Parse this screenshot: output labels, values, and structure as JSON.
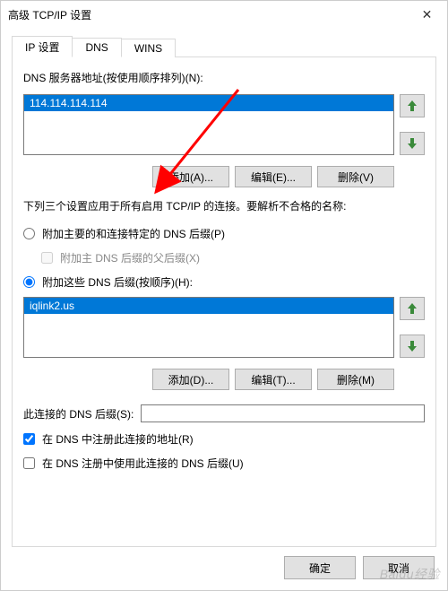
{
  "window": {
    "title": "高级 TCP/IP 设置",
    "close_glyph": "✕"
  },
  "tabs": {
    "ip": "IP 设置",
    "dns": "DNS",
    "wins": "WINS"
  },
  "dns": {
    "server_list_label": "DNS 服务器地址(按使用顺序排列)(N):",
    "servers": [
      "114.114.114.114"
    ],
    "btn_add": "添加(A)...",
    "btn_edit": "编辑(E)...",
    "btn_remove": "删除(V)",
    "resolve_desc": "下列三个设置应用于所有启用 TCP/IP 的连接。要解析不合格的名称:",
    "radio_primary": "附加主要的和连接特定的 DNS 后缀(P)",
    "check_parent": "附加主 DNS 后缀的父后缀(X)",
    "radio_these": "附加这些 DNS 后缀(按顺序)(H):",
    "suffixes": [
      "iqlink2.us"
    ],
    "btn_add2": "添加(D)...",
    "btn_edit2": "编辑(T)...",
    "btn_remove2": "删除(M)",
    "conn_suffix_label": "此连接的 DNS 后缀(S):",
    "conn_suffix_value": "",
    "check_register": "在 DNS 中注册此连接的地址(R)",
    "check_use_suffix": "在 DNS 注册中使用此连接的 DNS 后缀(U)"
  },
  "dialog": {
    "ok": "确定",
    "cancel": "取消"
  },
  "watermark": "Baidu经验"
}
